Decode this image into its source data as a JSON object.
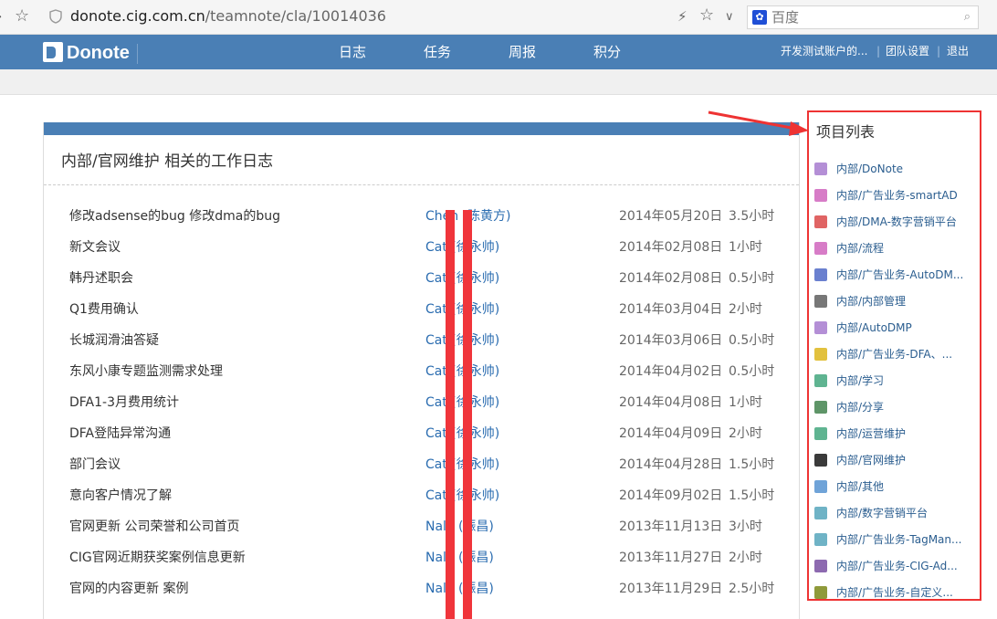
{
  "browser": {
    "url_host": "donote.cig.com.cn",
    "url_path": "/teamnote/cla/10014036",
    "search_placeholder": "百度"
  },
  "header": {
    "logo": "Donote",
    "nav": [
      "日志",
      "任务",
      "周报",
      "积分"
    ],
    "account": "开发测试账户的...",
    "team_settings": "团队设置",
    "logout": "退出",
    "separator": "|"
  },
  "panel": {
    "title": "内部/官网维护 相关的工作日志",
    "rows": [
      {
        "task": "修改adsense的bug 修改dma的bug",
        "owner": "Chen (陈黄方)",
        "date": "2014年05月20日",
        "hours": "3.5小时"
      },
      {
        "task": "新文会议",
        "owner": "Cat (徐永帅)",
        "date": "2014年02月08日",
        "hours": "1小时"
      },
      {
        "task": "韩丹述职会",
        "owner": "Cat (徐永帅)",
        "date": "2014年02月08日",
        "hours": "0.5小时"
      },
      {
        "task": "Q1费用确认",
        "owner": "Cat (徐永帅)",
        "date": "2014年03月04日",
        "hours": "2小时"
      },
      {
        "task": "长城润滑油答疑",
        "owner": "Cat (徐永帅)",
        "date": "2014年03月06日",
        "hours": "0.5小时"
      },
      {
        "task": "东风小康专题监测需求处理",
        "owner": "Cat (徐永帅)",
        "date": "2014年04月02日",
        "hours": "0.5小时"
      },
      {
        "task": "DFA1-3月费用统计",
        "owner": "Cat (徐永帅)",
        "date": "2014年04月08日",
        "hours": "1小时"
      },
      {
        "task": "DFA登陆异常沟通",
        "owner": "Cat (徐永帅)",
        "date": "2014年04月09日",
        "hours": "2小时"
      },
      {
        "task": "部门会议",
        "owner": "Cat (徐永帅)",
        "date": "2014年04月28日",
        "hours": "1.5小时"
      },
      {
        "task": "意向客户情况了解",
        "owner": "Cat (徐永帅)",
        "date": "2014年09月02日",
        "hours": "1.5小时"
      },
      {
        "task": "官网更新 公司荣誉和公司首页",
        "owner": "Nala (振昌)",
        "date": "2013年11月13日",
        "hours": "3小时"
      },
      {
        "task": "CIG官网近期获奖案例信息更新",
        "owner": "Nala (振昌)",
        "date": "2013年11月27日",
        "hours": "2小时"
      },
      {
        "task": "官网的内容更新 案例",
        "owner": "Nala (振昌)",
        "date": "2013年11月29日",
        "hours": "2.5小时"
      }
    ]
  },
  "sidebar": {
    "title": "项目列表",
    "items": [
      {
        "label": "内部/DoNote",
        "color": "#b48fd6"
      },
      {
        "label": "内部/广告业务-smartAD",
        "color": "#d77cc7"
      },
      {
        "label": "内部/DMA-数字营销平台",
        "color": "#e06464"
      },
      {
        "label": "内部/流程",
        "color": "#d77cc7"
      },
      {
        "label": "内部/广告业务-AutoDM...",
        "color": "#6a80cf"
      },
      {
        "label": "内部/内部管理",
        "color": "#777777"
      },
      {
        "label": "内部/AutoDMP",
        "color": "#b48fd6"
      },
      {
        "label": "内部/广告业务-DFA、...",
        "color": "#e2c13e"
      },
      {
        "label": "内部/学习",
        "color": "#5fb491"
      },
      {
        "label": "内部/分享",
        "color": "#5e9568"
      },
      {
        "label": "内部/运营维护",
        "color": "#5fb491"
      },
      {
        "label": "内部/官网维护",
        "color": "#3a3a3a"
      },
      {
        "label": "内部/其他",
        "color": "#6fa3d8"
      },
      {
        "label": "内部/数字营销平台",
        "color": "#6fb3c6"
      },
      {
        "label": "内部/广告业务-TagMan...",
        "color": "#6fb3c6"
      },
      {
        "label": "内部/广告业务-CIG-Ad...",
        "color": "#8d6ab0"
      },
      {
        "label": "内部/广告业务-自定义...",
        "color": "#8f9a3a"
      }
    ]
  },
  "colors": {
    "header_bg": "#4a7fb5",
    "annotation_red": "#ee3333",
    "link": "#2a6cb0"
  }
}
